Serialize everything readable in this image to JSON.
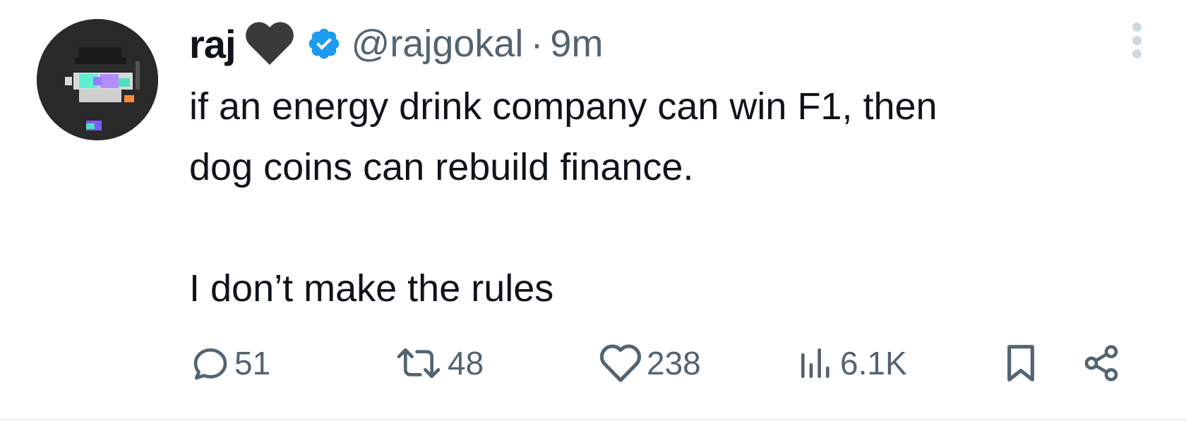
{
  "tweet": {
    "author_name": "raj",
    "author_emoji": "🖤",
    "verified_icon": "verified-badge-icon",
    "handle": "@rajgokal",
    "separator": "·",
    "time": "9m",
    "text_lines": [
      "if an energy drink company can win F1, then",
      "dog coins can rebuild finance.",
      "",
      "I don’t make the rules"
    ]
  },
  "actions": {
    "reply_count": "51",
    "retweet_count": "48",
    "like_count": "238",
    "views_count": "6.1K"
  },
  "colors": {
    "verified_blue": "#1d9bf0",
    "muted_text": "#536471",
    "primary_text": "#0f1419"
  }
}
